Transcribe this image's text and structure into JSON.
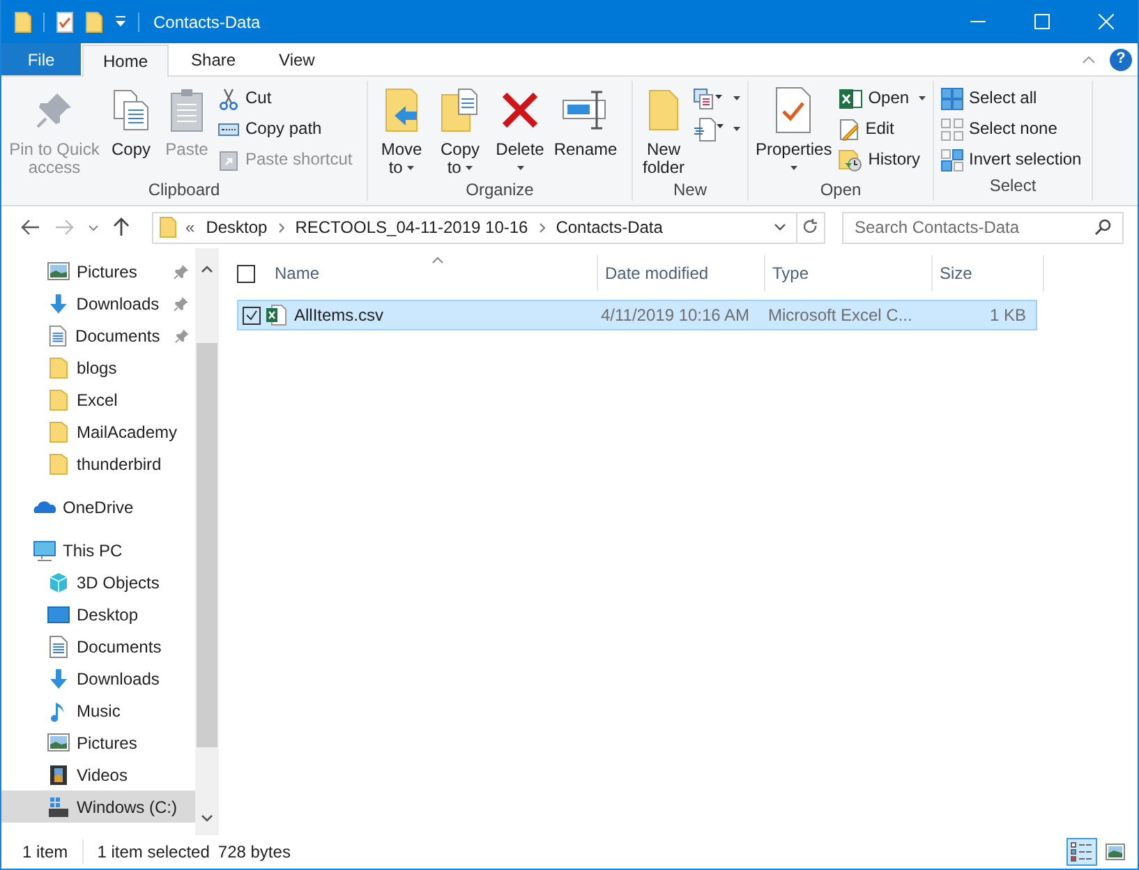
{
  "window": {
    "title": "Contacts-Data"
  },
  "ribbon_tabs": [
    {
      "label": "File",
      "kind": "file",
      "selected": false
    },
    {
      "label": "Home",
      "kind": "tab",
      "selected": true
    },
    {
      "label": "Share",
      "kind": "tab",
      "selected": false
    },
    {
      "label": "View",
      "kind": "tab",
      "selected": false
    }
  ],
  "help": {
    "label": "?"
  },
  "ribbon_groups": [
    {
      "label": "Clipboard",
      "items": [
        {
          "kind": "large",
          "label": "Pin to Quick access",
          "disabled": true,
          "dropdown": false
        },
        {
          "kind": "large",
          "label": "Copy",
          "disabled": false,
          "dropdown": false
        },
        {
          "kind": "large",
          "label": "Paste",
          "disabled": true,
          "dropdown": false
        },
        {
          "kind": "small",
          "label": "Cut",
          "disabled": false,
          "dropdown": false
        },
        {
          "kind": "small",
          "label": "Copy path",
          "disabled": false,
          "dropdown": false
        },
        {
          "kind": "small",
          "label": "Paste shortcut",
          "disabled": true,
          "dropdown": false
        }
      ]
    },
    {
      "label": "Organize",
      "items": [
        {
          "kind": "large",
          "label": "Move to",
          "disabled": false,
          "dropdown": true
        },
        {
          "kind": "large",
          "label": "Copy to",
          "disabled": false,
          "dropdown": true
        },
        {
          "kind": "large",
          "label": "Delete",
          "disabled": false,
          "dropdown": true
        },
        {
          "kind": "large",
          "label": "Rename",
          "disabled": false,
          "dropdown": false
        }
      ]
    },
    {
      "label": "New",
      "items": [
        {
          "kind": "large",
          "label": "New folder",
          "disabled": false,
          "dropdown": false
        },
        {
          "kind": "small",
          "disabled": false,
          "dropdown": true
        },
        {
          "kind": "small",
          "disabled": false,
          "dropdown": true
        }
      ]
    },
    {
      "label": "Open",
      "items": [
        {
          "kind": "large",
          "label": "Properties",
          "disabled": false,
          "dropdown": true
        },
        {
          "kind": "small",
          "label": "Open",
          "disabled": false,
          "dropdown": true
        },
        {
          "kind": "small",
          "label": "Edit",
          "disabled": false,
          "dropdown": false
        },
        {
          "kind": "small",
          "label": "History",
          "disabled": false,
          "dropdown": false
        }
      ]
    },
    {
      "label": "Select",
      "items": [
        {
          "kind": "small",
          "label": "Select all",
          "disabled": false,
          "dropdown": false
        },
        {
          "kind": "small",
          "label": "Select none",
          "disabled": false,
          "dropdown": false
        },
        {
          "kind": "small",
          "label": "Invert selection",
          "disabled": false,
          "dropdown": false
        }
      ]
    }
  ],
  "address_bar": {
    "overflow": "«",
    "path": [
      "Desktop",
      "RECTOOLS_04-11-2019 10-16",
      "Contacts-Data"
    ]
  },
  "search": {
    "placeholder": "Search Contacts-Data"
  },
  "navigation": {
    "quick_access": [
      {
        "label": "Pictures",
        "pinned": true
      },
      {
        "label": "Downloads",
        "pinned": true
      },
      {
        "label": "Documents",
        "pinned": true
      },
      {
        "label": "blogs",
        "pinned": false
      },
      {
        "label": "Excel",
        "pinned": false
      },
      {
        "label": "MailAcademy",
        "pinned": false
      },
      {
        "label": "thunderbird",
        "pinned": false
      }
    ],
    "onedrive": {
      "label": "OneDrive"
    },
    "this_pc": {
      "label": "This PC",
      "children": [
        {
          "label": "3D Objects",
          "selected": false
        },
        {
          "label": "Desktop",
          "selected": false
        },
        {
          "label": "Documents",
          "selected": false
        },
        {
          "label": "Downloads",
          "selected": false
        },
        {
          "label": "Music",
          "selected": false
        },
        {
          "label": "Pictures",
          "selected": false
        },
        {
          "label": "Videos",
          "selected": false
        },
        {
          "label": "Windows (C:)",
          "selected": true
        }
      ]
    }
  },
  "file_list": {
    "all_checked": false,
    "columns": [
      {
        "label": "Name",
        "sorted": true
      },
      {
        "label": "Date modified",
        "sorted": false
      },
      {
        "label": "Type",
        "sorted": false
      },
      {
        "label": "Size",
        "sorted": false
      }
    ],
    "rows": [
      {
        "name": "AllItems.csv",
        "date_modified": "4/11/2019 10:16 AM",
        "type": "Microsoft Excel C...",
        "size": "1 KB",
        "selected": true,
        "checked": true
      }
    ]
  },
  "status_bar": {
    "item_count": "1 item",
    "selection": "1 item selected",
    "selection_size": "728 bytes"
  },
  "views": [
    {
      "kind": "details",
      "selected": true
    },
    {
      "kind": "large_icons",
      "selected": false
    }
  ]
}
